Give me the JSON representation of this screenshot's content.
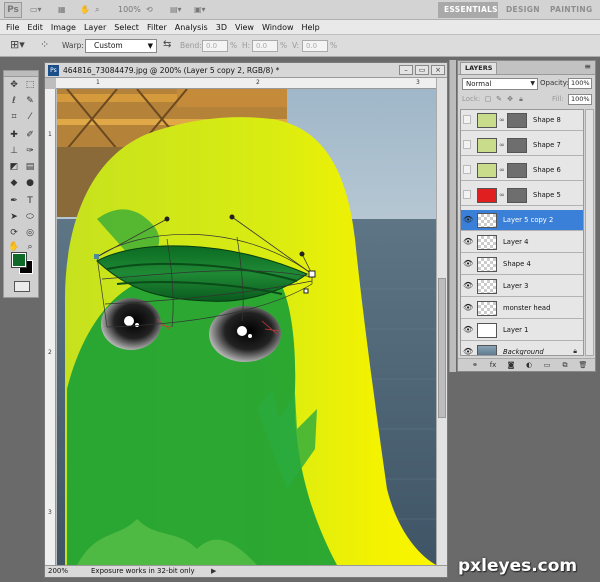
{
  "app": {
    "logo": "Ps",
    "zoom_display": "100%",
    "workspaces": [
      "ESSENTIALS",
      "DESIGN",
      "PAINTING"
    ]
  },
  "menu": [
    "File",
    "Edit",
    "Image",
    "Layer",
    "Select",
    "Filter",
    "Analysis",
    "3D",
    "View",
    "Window",
    "Help"
  ],
  "options": {
    "warp_label": "Warp:",
    "warp_value": "Custom",
    "bend_label": "Bend:",
    "bend_value": "0.0",
    "h_label": "H:",
    "h_value": "0.0",
    "v_label": "V:",
    "v_value": "0.0",
    "pct": "%"
  },
  "document": {
    "icon": "Ps",
    "title": "464816_73084479.jpg @ 200% (Layer 5 copy 2, RGB/8) *",
    "ruler_top_nums": [
      "1",
      "2",
      "3"
    ],
    "ruler_left_nums": [
      "1",
      "2",
      "3"
    ],
    "zoom": "200%",
    "status": "Exposure works in 32-bit only",
    "status_arrow": "▶"
  },
  "layers_panel": {
    "tab": "LAYERS",
    "blend_mode": "Normal",
    "opacity_label": "Opacity:",
    "opacity_value": "100%",
    "lock_label": "Lock:",
    "fill_label": "Fill:",
    "fill_value": "100%",
    "layers": [
      {
        "name": "Shape 8",
        "visible": false,
        "thumb": "#c8dc8c",
        "mask": true
      },
      {
        "name": "Shape 7",
        "visible": false,
        "thumb": "#c8dc8c",
        "mask": true
      },
      {
        "name": "Shape 6",
        "visible": false,
        "thumb": "#c8dc8c",
        "mask": true
      },
      {
        "name": "Shape 5",
        "visible": false,
        "thumb": "#e02020",
        "mask": true
      },
      {
        "name": "Layer 5 copy 2",
        "visible": true,
        "thumb": "checker",
        "selected": true
      },
      {
        "name": "Layer 4",
        "visible": true,
        "thumb": "checker"
      },
      {
        "name": "Shape 4",
        "visible": true,
        "thumb": "checker"
      },
      {
        "name": "Layer 3",
        "visible": true,
        "thumb": "checker"
      },
      {
        "name": "monster head",
        "visible": true,
        "thumb": "checker"
      },
      {
        "name": "Layer 1",
        "visible": true,
        "thumb": "#ffffff"
      },
      {
        "name": "Background",
        "visible": true,
        "thumb": "#6a8aa2",
        "italic": true,
        "locked": true
      }
    ]
  },
  "colors": {
    "foreground": "#0f6a2a",
    "background": "#000000",
    "selection": "#3a7fd8"
  },
  "watermark": "pxleyes.com"
}
